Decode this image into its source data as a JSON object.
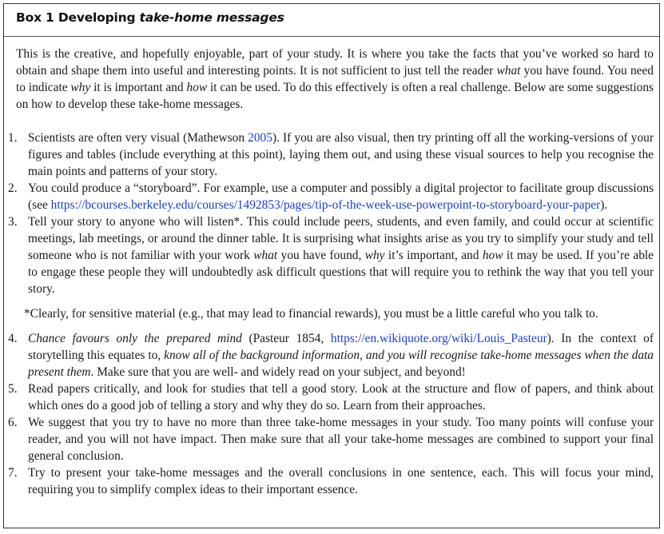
{
  "box": {
    "label": "Box 1 Developing ",
    "label_italic": "take-home messages"
  },
  "intro": {
    "p1": "This is the creative, and hopefully enjoyable, part of your study. It is where you take the facts that you’ve worked so hard to obtain and shape them into useful and interesting points. It is not sufficient to just tell the reader ",
    "what": "what",
    "p2": " you have found. You need to indicate ",
    "why": "why",
    "p3": " it is important and ",
    "how": "how",
    "p4": " it can be used. To do this effectively is often a real challenge. Below are some suggestions on how to develop these take-home messages."
  },
  "items": [
    {
      "num": "1.",
      "a": "Scientists are often very visual (Mathewson ",
      "link": "2005",
      "b": "). If you are also visual, then try printing off all the working-versions of your figures and tables (include everything at this point), laying them out, and using these visual sources to help you recognise the main points and patterns of your story."
    },
    {
      "num": "2.",
      "a": "You could produce a “storyboard”. For example, use a computer and possibly a digital projector to facilitate group discussions (see ",
      "link": "https://bcourses.berkeley.edu/courses/1492853/pages/tip-of-the-week-use-powerpoint-to-storyboard-your-paper",
      "b": ")."
    },
    {
      "num": "3.",
      "a": "Tell your story to anyone who will listen*. This could include peers, students, and even family, and could occur at scientific meetings, lab meetings, or around the dinner table. It is surprising what insights arise as you try to simplify your study and tell someone who is not familiar with your work ",
      "what": "what",
      "b": " you have found, ",
      "why": "why",
      "c": " it’s important, and ",
      "how": "how",
      "d": " it may be used. If you’re able to engage these people they will undoubtedly ask difficult questions that will require you to rethink the way that you tell your story."
    },
    {
      "num": "4.",
      "quote": "Chance favours only the prepared mind",
      "a": " (Pasteur 1854, ",
      "link": "https://en.wikiquote.org/wiki/Louis_Pasteur",
      "b": "). In the context of storytelling this equates to, ",
      "emph": "know all of the background information, and you will recognise take-home messages when the data present them",
      "c": ". Make sure that you are well- and widely read on your subject, and beyond!"
    },
    {
      "num": "5.",
      "a": "Read papers critically, and look for studies that tell a good story. Look at the structure and flow of papers, and think about which ones do a good job of telling a story and why they do so. Learn from their approaches."
    },
    {
      "num": "6.",
      "a": "We suggest that you try to have no more than three take-home messages in your study. Too many points will confuse your reader, and you will not have impact. Then make sure that all your take-home messages are combined to support your final general conclusion."
    },
    {
      "num": "7.",
      "a": "Try to present your take-home messages and the overall conclusions in one sentence, each. This will focus your mind, requiring you to simplify complex ideas to their important essence."
    }
  ],
  "footnote": "*Clearly, for sensitive material (e.g., that may lead to financial rewards), you must be a little careful who you talk to.",
  "colors": {
    "link": "#1f3fbf",
    "border": "#333333"
  }
}
